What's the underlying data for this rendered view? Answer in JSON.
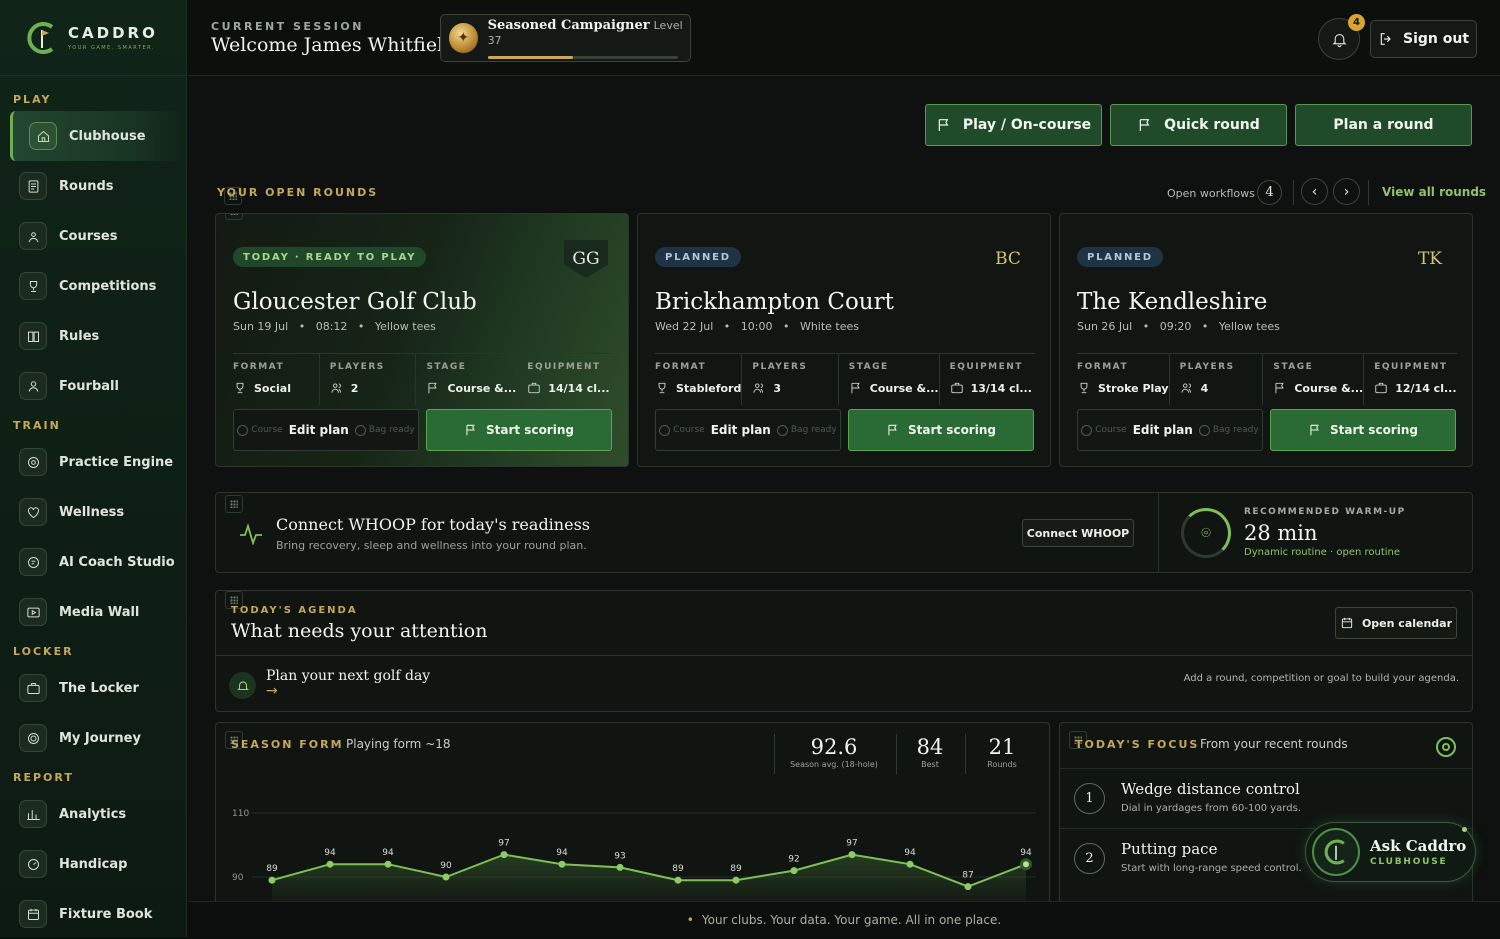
{
  "brand": {
    "name": "CADDRO",
    "tagline": "YOUR GAME. SMARTER.",
    "accent": "#6fae53",
    "gold": "#c5a85a"
  },
  "sidebar": {
    "sections": [
      {
        "label": "PLAY",
        "items": [
          {
            "label": "Clubhouse",
            "icon": "home-icon",
            "active": true
          },
          {
            "label": "Rounds",
            "icon": "scorecard-icon"
          },
          {
            "label": "Courses",
            "icon": "map-pin-icon"
          },
          {
            "label": "Competitions",
            "icon": "trophy-icon"
          },
          {
            "label": "Rules",
            "icon": "book-icon"
          },
          {
            "label": "Fourball",
            "icon": "users-icon"
          }
        ]
      },
      {
        "label": "TRAIN",
        "items": [
          {
            "label": "Practice Engine",
            "icon": "target-icon"
          },
          {
            "label": "Wellness",
            "icon": "heart-icon"
          },
          {
            "label": "AI Coach Studio",
            "icon": "coach-icon"
          },
          {
            "label": "Media Wall",
            "icon": "video-icon"
          }
        ]
      },
      {
        "label": "LOCKER",
        "items": [
          {
            "label": "The Locker",
            "icon": "briefcase-icon"
          },
          {
            "label": "My Journey",
            "icon": "compass-icon"
          }
        ]
      },
      {
        "label": "REPORT",
        "items": [
          {
            "label": "Analytics",
            "icon": "chart-icon"
          },
          {
            "label": "Handicap",
            "icon": "gauge-icon"
          },
          {
            "label": "Fixture Book",
            "icon": "calendar-icon"
          }
        ]
      }
    ]
  },
  "header": {
    "session_label": "CURRENT SESSION",
    "welcome": "Welcome James Whitfield",
    "badge_title": "Seasoned Campaigner",
    "badge_level": "Level 37",
    "xp_progress": 0.45,
    "notifications": "4",
    "signout": "Sign out"
  },
  "actions": {
    "play": "Play / On-course",
    "quick": "Quick round",
    "plan": "Plan a round"
  },
  "open_rounds": {
    "label": "YOUR OPEN ROUNDS",
    "workflows_label": "Open workflows",
    "workflows_count": "4",
    "view_all": "View all rounds",
    "cards": [
      {
        "status": "TODAY · READY TO PLAY",
        "mono": "GG",
        "title": "Gloucester Golf Club",
        "date": "Sun 19 Jul",
        "time": "08:12",
        "tees": "Yellow tees",
        "format": "Social",
        "players": "2",
        "stage": "Course &...",
        "equipment": "14/14 cl..."
      },
      {
        "status": "PLANNED",
        "mono": "BC",
        "title": "Brickhampton Court",
        "date": "Wed 22 Jul",
        "time": "10:00",
        "tees": "White tees",
        "format": "Stableford",
        "players": "3",
        "stage": "Course &...",
        "equipment": "13/14 cl..."
      },
      {
        "status": "PLANNED",
        "mono": "TK",
        "title": "The Kendleshire",
        "date": "Sun 26 Jul",
        "time": "09:20",
        "tees": "Yellow tees",
        "format": "Stroke Play",
        "players": "4",
        "stage": "Course &...",
        "equipment": "12/14 cl..."
      }
    ],
    "labels": {
      "format": "FORMAT",
      "players": "PLAYERS",
      "stage": "STAGE",
      "equipment": "EQUIPMENT",
      "course_chip": "Course",
      "bag_chip": "Bag ready",
      "edit": "Edit plan",
      "start": "Start scoring",
      "sep": "•"
    }
  },
  "whoop": {
    "title": "Connect WHOOP for today's readiness",
    "sub": "Bring recovery, sleep and wellness into your round plan.",
    "button": "Connect WHOOP"
  },
  "warmup": {
    "label": "RECOMMENDED WARM-UP",
    "value": "28 min",
    "sub": "Dynamic routine · open routine"
  },
  "agenda": {
    "label": "TODAY'S AGENDA",
    "title": "What needs your attention",
    "button": "Open calendar",
    "item": "Plan your next golf day",
    "hint": "Add a round, competition or goal to build your agenda."
  },
  "season": {
    "label": "SEASON FORM",
    "playing_form": "Playing form ~18",
    "avg": "92.6",
    "avg_label": "Season avg. (18-hole)",
    "best": "84",
    "best_label": "Best",
    "rounds": "21",
    "rounds_label": "Rounds"
  },
  "chart_data": {
    "type": "line",
    "x": [
      1,
      2,
      3,
      4,
      5,
      6,
      7,
      8,
      9,
      10,
      11,
      12,
      13,
      14
    ],
    "series": [
      {
        "values": [
          89,
          94,
          94,
          90,
          97,
          94,
          93,
          89,
          89,
          92,
          97,
          94,
          87,
          94
        ]
      }
    ],
    "yticks": [
      110,
      90
    ],
    "ylim": [
      85,
      110
    ],
    "line_color": "#7fbf5a"
  },
  "focus": {
    "label": "TODAY'S FOCUS",
    "sub": "From your recent rounds",
    "items": [
      {
        "num": "1",
        "title": "Wedge distance control",
        "desc": "Dial in yardages from 60-100 yards."
      },
      {
        "num": "2",
        "title": "Putting pace",
        "desc": "Start with long-range speed control."
      }
    ]
  },
  "ask": {
    "title": "Ask Caddro",
    "sub": "CLUBHOUSE"
  },
  "footer": {
    "dot": "•",
    "text": "Your clubs. Your data. Your game. All in one place."
  }
}
